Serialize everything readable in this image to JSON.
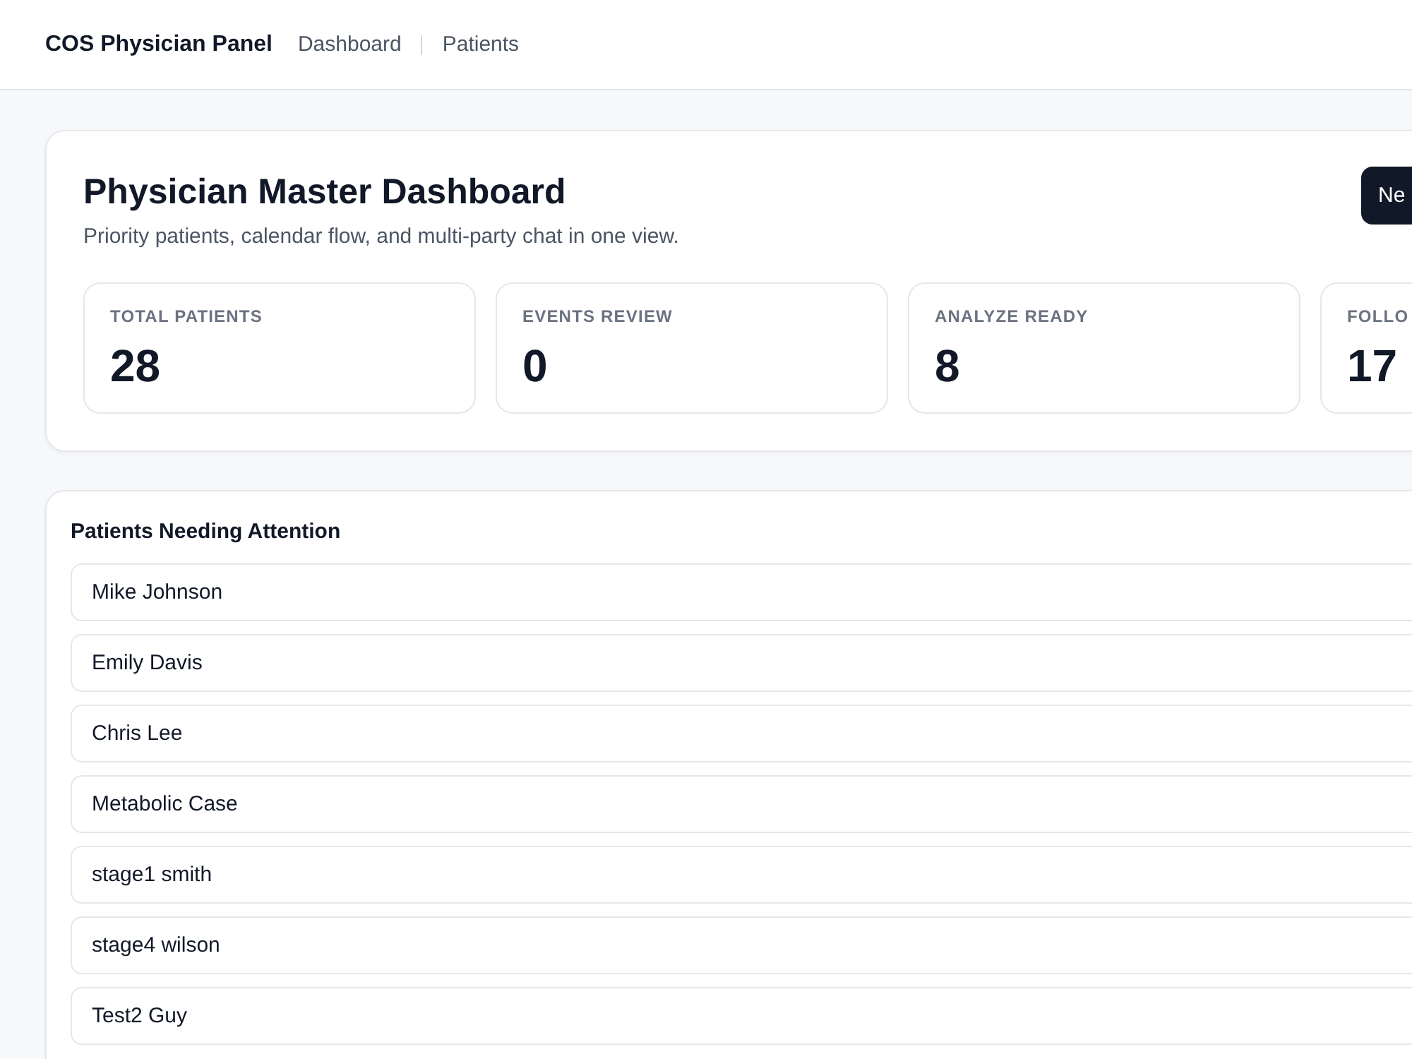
{
  "app": {
    "title": "COS Physician Panel"
  },
  "nav": [
    {
      "label": "Dashboard",
      "selected": false
    },
    {
      "label": "Patients",
      "selected": false
    }
  ],
  "header": {
    "title": "Physician Master Dashboard",
    "subtitle": "Priority patients, calendar flow, and multi-party chat in one view.",
    "button": "Ne"
  },
  "stats": [
    {
      "label": "TOTAL PATIENTS",
      "value": "28"
    },
    {
      "label": "EVENTS REVIEW",
      "value": "0"
    },
    {
      "label": "ANALYZE READY",
      "value": "8"
    },
    {
      "label": "FOLLO",
      "value": "17"
    }
  ],
  "attention": {
    "title": "Patients Needing Attention",
    "patients": [
      "Mike Johnson",
      "Emily Davis",
      "Chris Lee",
      "Metabolic Case",
      "stage1 smith",
      "stage4 wilson",
      "Test2 Guy"
    ]
  }
}
